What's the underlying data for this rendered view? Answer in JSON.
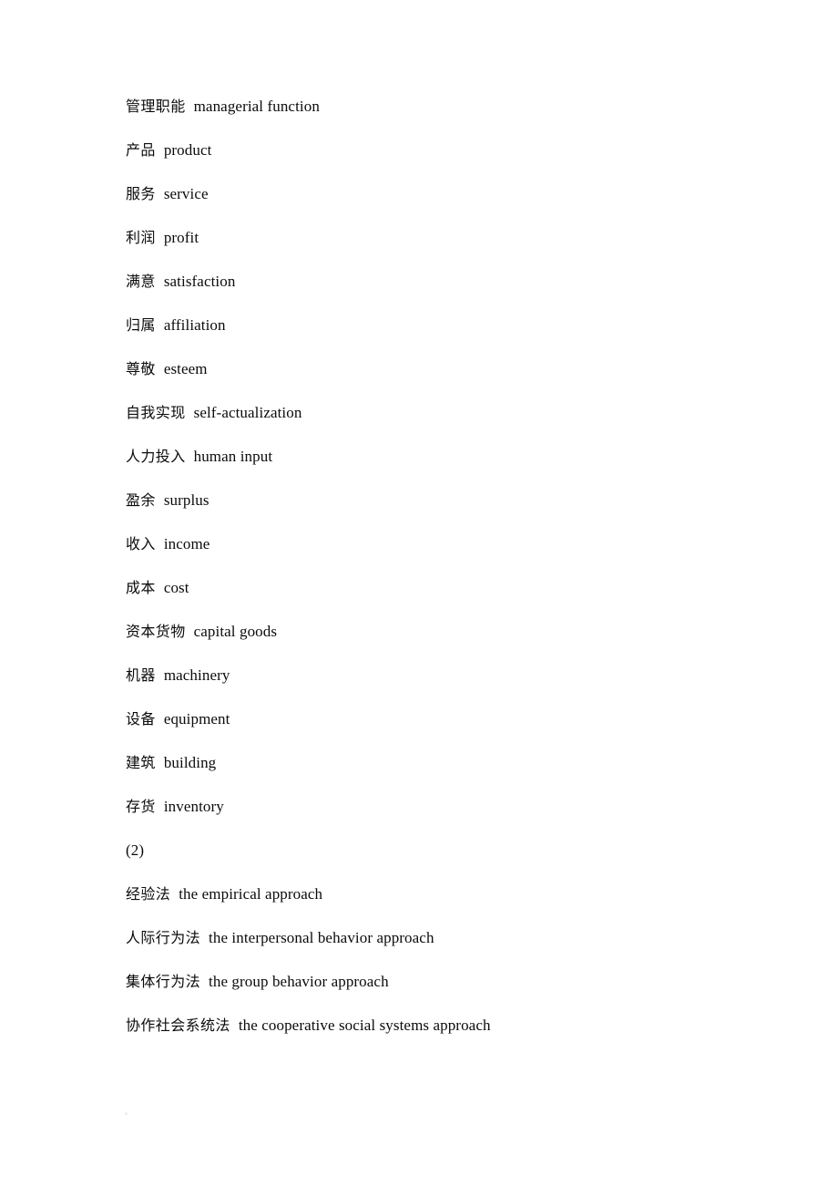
{
  "document": {
    "page_background": "#ffffff",
    "text_color": "#0b0b0b",
    "lines": [
      {
        "cn": "管理职能",
        "en": "managerial function"
      },
      {
        "cn": "产品",
        "en": "product"
      },
      {
        "cn": "服务",
        "en": "service"
      },
      {
        "cn": "利润",
        "en": "profit"
      },
      {
        "cn": "满意",
        "en": "satisfaction"
      },
      {
        "cn": "归属",
        "en": "affiliation"
      },
      {
        "cn": "尊敬",
        "en": "esteem"
      },
      {
        "cn": "自我实现",
        "en": "self-actualization"
      },
      {
        "cn": "人力投入",
        "en": "human input"
      },
      {
        "cn": "盈余",
        "en": "surplus"
      },
      {
        "cn": "收入",
        "en": "income"
      },
      {
        "cn": "成本",
        "en": "cost"
      },
      {
        "cn": "资本货物",
        "en": "capital goods"
      },
      {
        "cn": "机器",
        "en": "machinery"
      },
      {
        "cn": "设备",
        "en": "equipment"
      },
      {
        "cn": "建筑",
        "en": "building"
      },
      {
        "cn": "存货",
        "en": "inventory"
      },
      {
        "cn": "(2)",
        "en": ""
      },
      {
        "cn": "经验法",
        "en": "the empirical approach"
      },
      {
        "cn": "人际行为法",
        "en": "the interpersonal behavior approach"
      },
      {
        "cn": "集体行为法",
        "en": "the group behavior approach"
      },
      {
        "cn": "协作社会系统法",
        "en": "the cooperative social systems approach"
      }
    ]
  }
}
